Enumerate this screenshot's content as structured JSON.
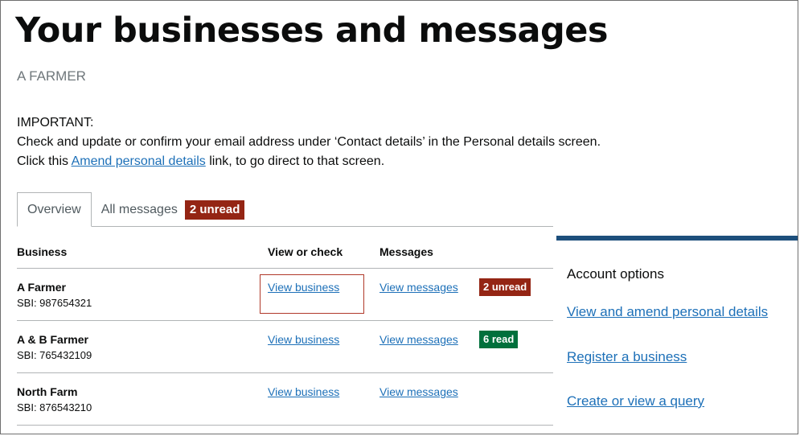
{
  "page": {
    "title": "Your businesses and messages",
    "user_name": "A FARMER"
  },
  "notice": {
    "heading": "IMPORTANT:",
    "line1": "Check and update or confirm your email address under ‘Contact details’ in the Personal details screen.",
    "line2_before": "Click this ",
    "line2_link": "Amend personal details",
    "line2_after": " link, to go direct to that screen."
  },
  "tabs": {
    "overview": "Overview",
    "all_messages": "All messages",
    "unread_badge": "2 unread"
  },
  "table": {
    "headers": {
      "business": "Business",
      "view_or_check": "View or check",
      "messages": "Messages"
    },
    "rows": [
      {
        "name": "A Farmer",
        "sbi": "SBI: 987654321",
        "view_link": "View business",
        "messages_link": "View messages",
        "badge": "2 unread",
        "badge_color": "#942514"
      },
      {
        "name": "A & B Farmer",
        "sbi": "SBI: 765432109",
        "view_link": "View business",
        "messages_link": "View messages",
        "badge": "6 read",
        "badge_color": "#00703c"
      },
      {
        "name": "North Farm",
        "sbi": "SBI: 876543210",
        "view_link": "View business",
        "messages_link": "View messages",
        "badge": "",
        "badge_color": ""
      }
    ]
  },
  "side": {
    "title": "Account options",
    "links": [
      "View and amend personal details",
      "Register a business",
      "Create or view a query"
    ]
  },
  "colors": {
    "link": "#1d70b8",
    "unread_badge": "#942514",
    "read_badge": "#00703c",
    "accent_bar": "#1d4f7c",
    "focus_outline": "#b0392a"
  }
}
